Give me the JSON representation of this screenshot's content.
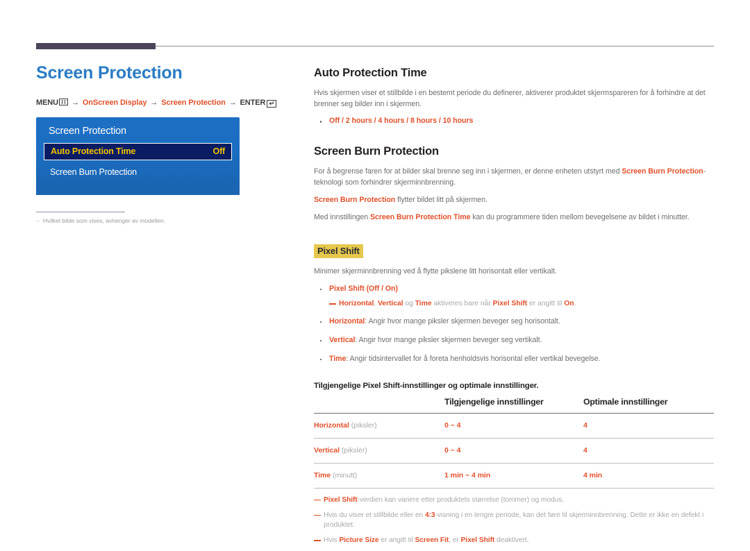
{
  "page": {
    "title": "Screen Protection",
    "breadcrumb": {
      "menu_label": "MENU",
      "menu_icon": "menu-bars-icon",
      "arrow": "→",
      "step1": "OnScreen Display",
      "step2": "Screen Protection",
      "enter_label": "ENTER",
      "enter_icon": "enter-return-icon",
      "enter_glyph": "↵"
    }
  },
  "osd": {
    "title": "Screen Protection",
    "rows": [
      {
        "label": "Auto Protection Time",
        "value": "Off",
        "selected": true
      },
      {
        "label": "Screen Burn Protection",
        "value": "",
        "selected": false
      }
    ]
  },
  "left_note": {
    "dash": "–",
    "text": "Hvilket bilde som vises, avhenger av modellen."
  },
  "sections": {
    "auto_protection_time": {
      "heading": "Auto Protection Time",
      "paragraph": "Hvis skjermen viser et stillbilde i en bestemt periode du definerer, aktiverer produktet skjermspareren for å forhindre at det brenner seg bilder inn i skjermen.",
      "bullet": "Off / 2 hours / 4 hours / 8 hours / 10 hours"
    },
    "screen_burn_protection": {
      "heading": "Screen Burn Protection",
      "p1_a": "For å begrense faren for at bilder skal brenne seg inn i skjermen, er denne enheten utstyrt med ",
      "p1_b": "Screen Burn Protection",
      "p1_c": "-teknologi som forhindrer skjerminnbrenning.",
      "p2_a": "Screen Burn Protection",
      "p2_b": " flytter bildet litt på skjermen.",
      "p3_a": "Med innstillingen ",
      "p3_b": "Screen Burn Protection Time",
      "p3_c": " kan du programmere tiden mellom bevegelsene av bildet i minutter."
    },
    "pixel_shift": {
      "chip": "Pixel Shift",
      "intro": "Minimer skjerminnbrenning ved å flytte pikslene litt horisontalt eller vertikalt.",
      "bullets": [
        {
          "label": "Pixel Shift",
          "rest": " (Off / On)",
          "all_orange": true
        },
        {
          "label": "Horizontal",
          "rest": ": Angir hvor mange piksler skjermen beveger seg horisontalt.",
          "all_orange": false
        },
        {
          "label": "Vertical",
          "rest": ": Angir hvor mange piksler skjermen beveger seg vertikalt.",
          "all_orange": false
        },
        {
          "label": "Time",
          "rest": ": Angir tidsintervallet for å foreta henholdsvis horisontal eller vertikal bevegelse.",
          "all_orange": false
        }
      ],
      "subnote": {
        "a": "Horizontal",
        "b": ", ",
        "c": "Vertical",
        "d": " og ",
        "e": "Time",
        "f": " aktiveres bare når ",
        "g": "Pixel Shift",
        "h": " er angitt til ",
        "i": "On",
        "j": "."
      }
    }
  },
  "table": {
    "caption": "Tilgjengelige Pixel Shift-innstillinger og optimale innstillinger.",
    "headers": [
      "",
      "Tilgjengelige innstillinger",
      "Optimale innstillinger"
    ],
    "rows": [
      {
        "label": "Horizontal",
        "unit": " (piksler)",
        "available": "0 ~ 4",
        "optimal": "4"
      },
      {
        "label": "Vertical",
        "unit": " (piksler)",
        "available": "0 ~ 4",
        "optimal": "4"
      },
      {
        "label": "Time",
        "unit": " (minutt)",
        "available": "1 min ~ 4 min",
        "optimal": "4 min"
      }
    ]
  },
  "footnotes": [
    {
      "a": "Pixel Shift",
      "b": "-verdien kan variere etter produktets størrelse (tommer) og modus.",
      "c": "",
      "d": "",
      "e": ""
    },
    {
      "a": "",
      "b": "Hvis du viser et stillbilde eller en ",
      "c": "4:3",
      "d": "-visning i en lengre periode, kan det føre til skjerminnbrenning. Dette er ikke en defekt i produktet.",
      "e": ""
    },
    {
      "a": "",
      "b": "Hvis ",
      "c": "Picture Size",
      "d": " er angitt til ",
      "e": "Screen Fit",
      "f": ", er ",
      "g": "Pixel Shift",
      "h": " deaktivert."
    }
  ],
  "colors": {
    "accent_blue": "#2b7cc4",
    "accent_orange": "#e1502b",
    "osd_blue": "#1d6fc4",
    "osd_selected": "#0b1c63",
    "osd_selected_text": "#f2c200",
    "highlight_chip": "#e7c84f",
    "rule_purple": "#4c4459",
    "body_gray": "#6d6e71",
    "muted_gray": "#a7a9ac"
  }
}
